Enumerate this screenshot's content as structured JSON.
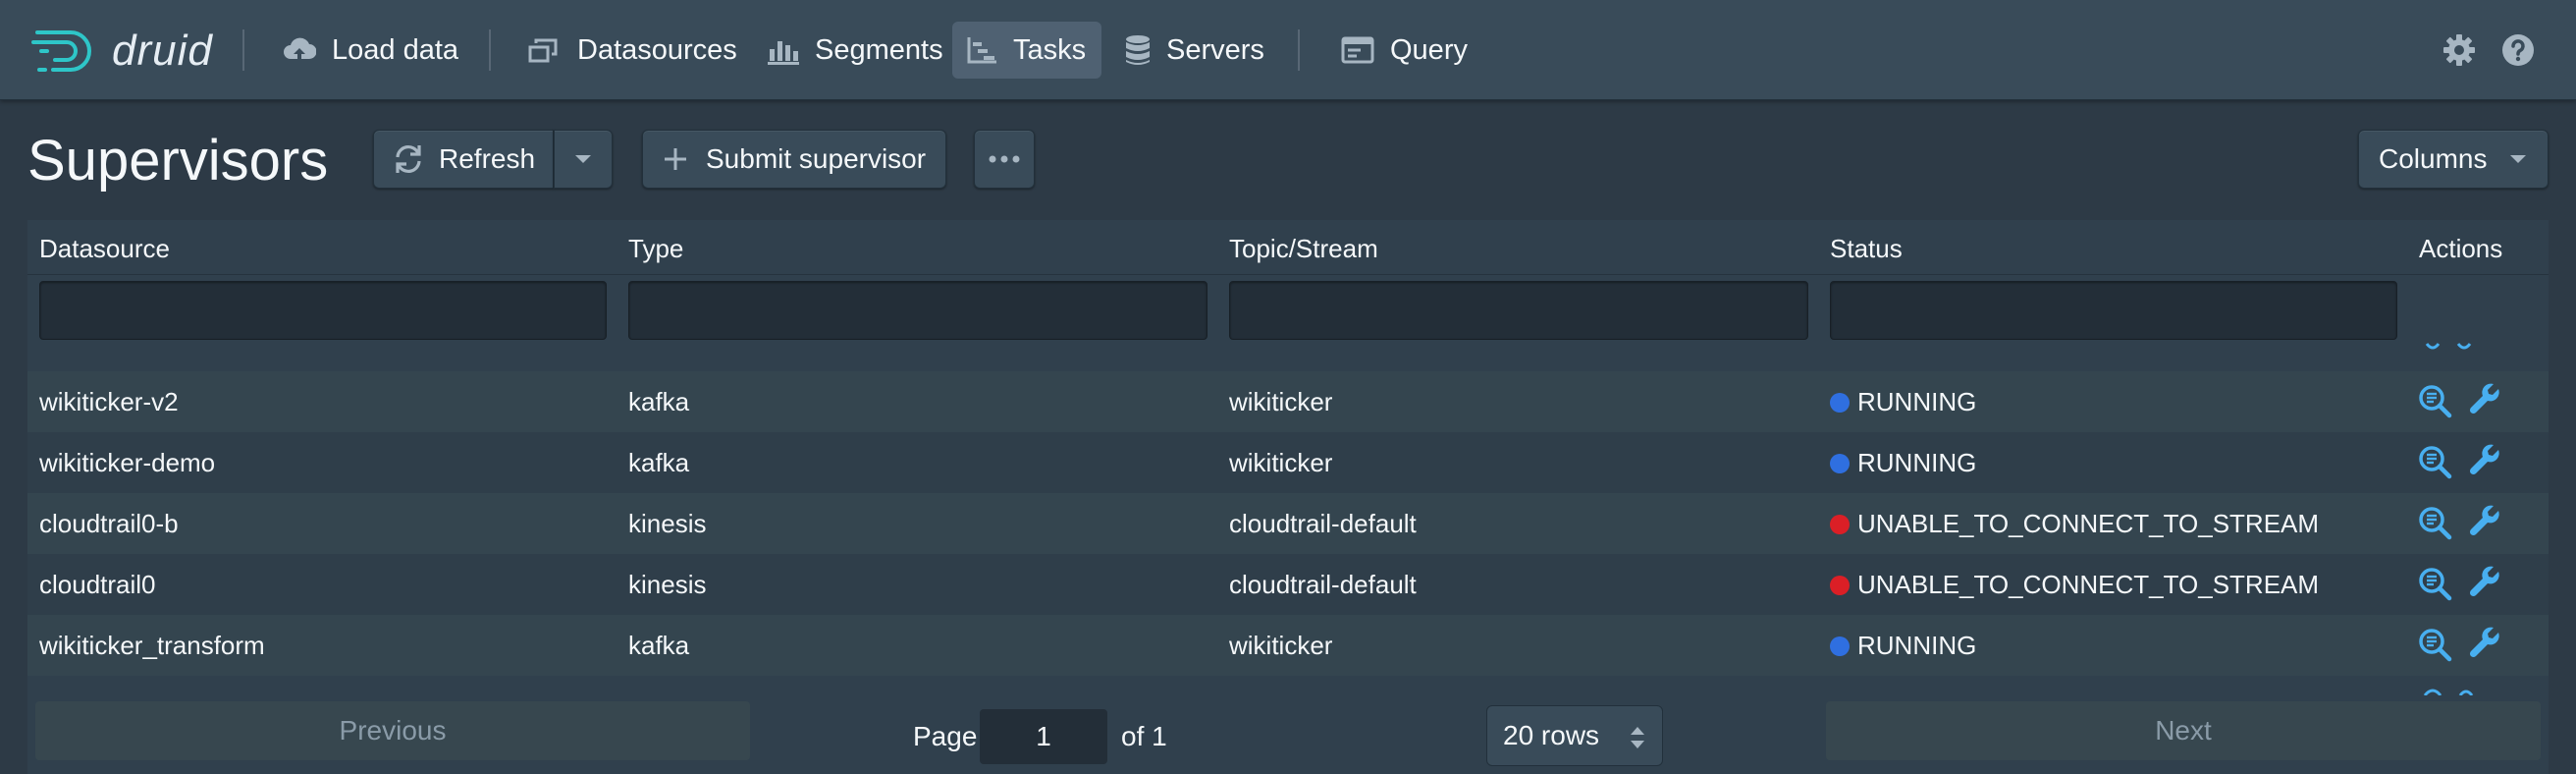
{
  "app": {
    "name": "druid"
  },
  "nav": {
    "items": [
      {
        "label": "Load data",
        "icon": "cloud-upload-icon"
      },
      {
        "label": "Datasources",
        "icon": "multi-select-icon"
      },
      {
        "label": "Segments",
        "icon": "stacked-chart-icon"
      },
      {
        "label": "Tasks",
        "icon": "gantt-chart-icon",
        "active": true
      },
      {
        "label": "Servers",
        "icon": "database-icon"
      },
      {
        "label": "Query",
        "icon": "application-icon"
      }
    ],
    "right_icons": [
      "gear-icon",
      "help-icon"
    ]
  },
  "toolbar": {
    "title": "Supervisors",
    "refresh_label": "Refresh",
    "submit_label": "Submit supervisor",
    "columns_label": "Columns"
  },
  "table": {
    "headers": [
      "Datasource",
      "Type",
      "Topic/Stream",
      "Status",
      "Actions"
    ],
    "rows": [
      {
        "datasource": "wikiticker-v2",
        "type": "kafka",
        "topic": "wikiticker",
        "status": "RUNNING",
        "status_color": "#2f6fe0"
      },
      {
        "datasource": "wikiticker-demo",
        "type": "kafka",
        "topic": "wikiticker",
        "status": "RUNNING",
        "status_color": "#2f6fe0"
      },
      {
        "datasource": "cloudtrail0-b",
        "type": "kinesis",
        "topic": "cloudtrail-default",
        "status": "UNABLE_TO_CONNECT_TO_STREAM",
        "status_color": "#db1f26"
      },
      {
        "datasource": "cloudtrail0",
        "type": "kinesis",
        "topic": "cloudtrail-default",
        "status": "UNABLE_TO_CONNECT_TO_STREAM",
        "status_color": "#db1f26"
      },
      {
        "datasource": "wikiticker_transform",
        "type": "kafka",
        "topic": "wikiticker",
        "status": "RUNNING",
        "status_color": "#2f6fe0"
      }
    ]
  },
  "pagination": {
    "previous_label": "Previous",
    "page_label": "Page",
    "page_value": "1",
    "of_label": "of 1",
    "rows_label": "20 rows",
    "next_label": "Next"
  },
  "colors": {
    "accent": "#48aff0",
    "running": "#2f6fe0",
    "error": "#db1f26"
  }
}
